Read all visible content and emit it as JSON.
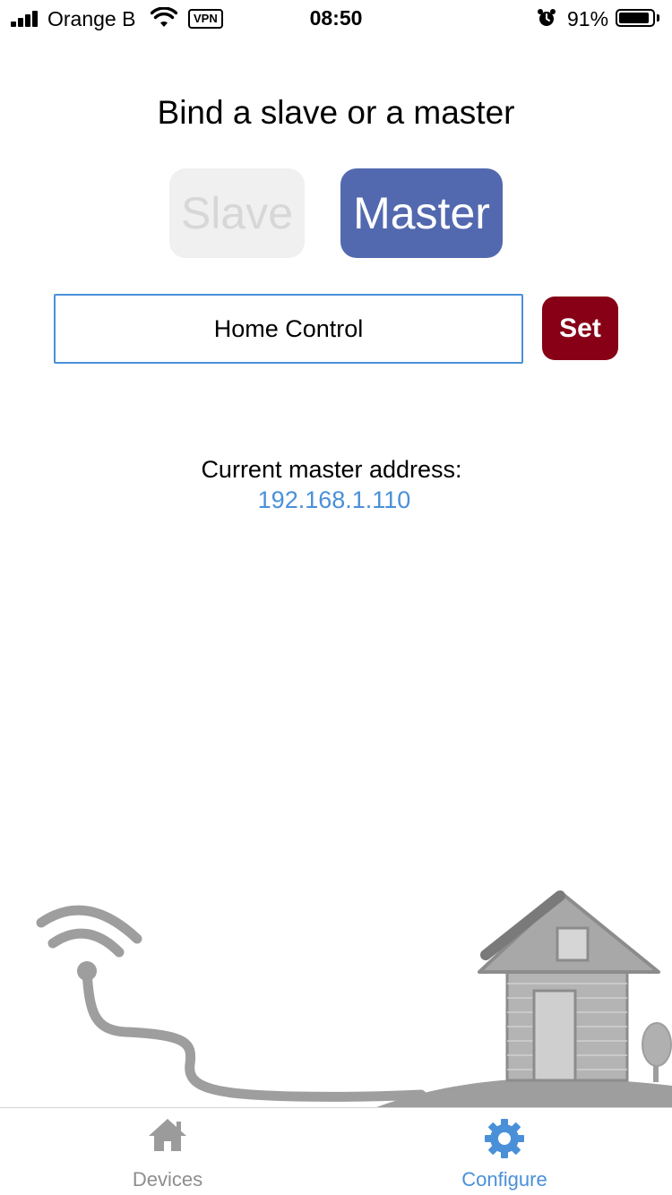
{
  "status_bar": {
    "carrier": "Orange B",
    "vpn": "VPN",
    "time": "08:50",
    "battery": "91%",
    "battery_level": 0.91,
    "icons": [
      "signal-icon",
      "wifi-icon",
      "alarm-icon",
      "battery-icon"
    ]
  },
  "main": {
    "title": "Bind a slave or a master",
    "slave_label": "Slave",
    "master_label": "Master",
    "selected_mode": "Master",
    "name_value": "Home Control",
    "set_label": "Set",
    "address_label": "Current master address:",
    "address_value": "192.168.1.110"
  },
  "tab_bar": {
    "tabs": [
      {
        "label": "Devices",
        "icon": "home-icon",
        "active": false
      },
      {
        "label": "Configure",
        "icon": "gear-icon",
        "active": true
      }
    ]
  },
  "colors": {
    "master_active": "#5369af",
    "slave_inactive_bg": "#f0f0f0",
    "set_button": "#870016",
    "link_blue": "#4a90d9",
    "tab_inactive": "#8e8e8e",
    "illustration_gray": "#9e9e9e"
  }
}
